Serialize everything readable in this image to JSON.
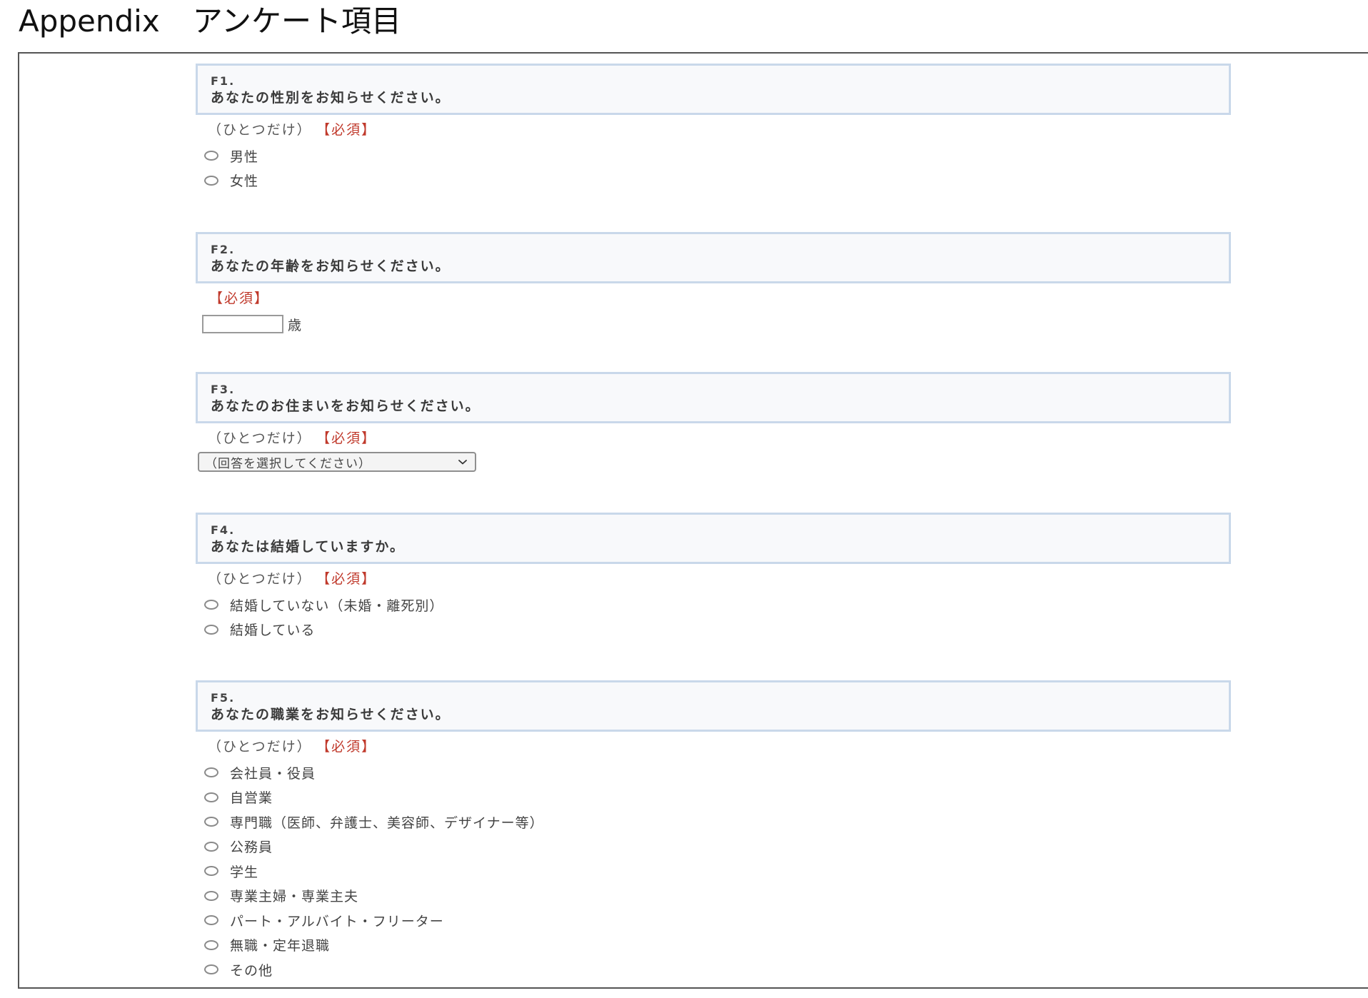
{
  "page_heading": {
    "appendix": "Appendix",
    "title": "アンケート項目"
  },
  "questions": {
    "f1": {
      "number": "F1.",
      "text": "あなたの性別をお知らせください。",
      "note": "（ひとつだけ）",
      "required": "【必須】",
      "options": [
        "男性",
        "女性"
      ]
    },
    "f2": {
      "number": "F2.",
      "text": "あなたの年齢をお知らせください。",
      "required": "【必須】",
      "input_value": "",
      "unit": "歳"
    },
    "f3": {
      "number": "F3.",
      "text": "あなたのお住まいをお知らせください。",
      "note": "（ひとつだけ）",
      "required": "【必須】",
      "select_value": "（回答を選択してください）"
    },
    "f4": {
      "number": "F4.",
      "text": "あなたは結婚していますか。",
      "note": "（ひとつだけ）",
      "required": "【必須】",
      "options": [
        "結婚していない（未婚・離死別）",
        "結婚している"
      ]
    },
    "f5": {
      "number": "F5.",
      "text": "あなたの職業をお知らせください。",
      "note": "（ひとつだけ）",
      "required": "【必須】",
      "options": [
        "会社員・役員",
        "自営業",
        "専門職（医師、弁護士、美容師、デザイナー等）",
        "公務員",
        "学生",
        "専業主婦・専業主夫",
        "パート・アルバイト・フリーター",
        "無職・定年退職",
        "その他"
      ]
    }
  },
  "colors": {
    "required_red": "#c0392b",
    "question_box_border": "#c9d8ea",
    "question_box_bg": "#f8f9fb"
  }
}
